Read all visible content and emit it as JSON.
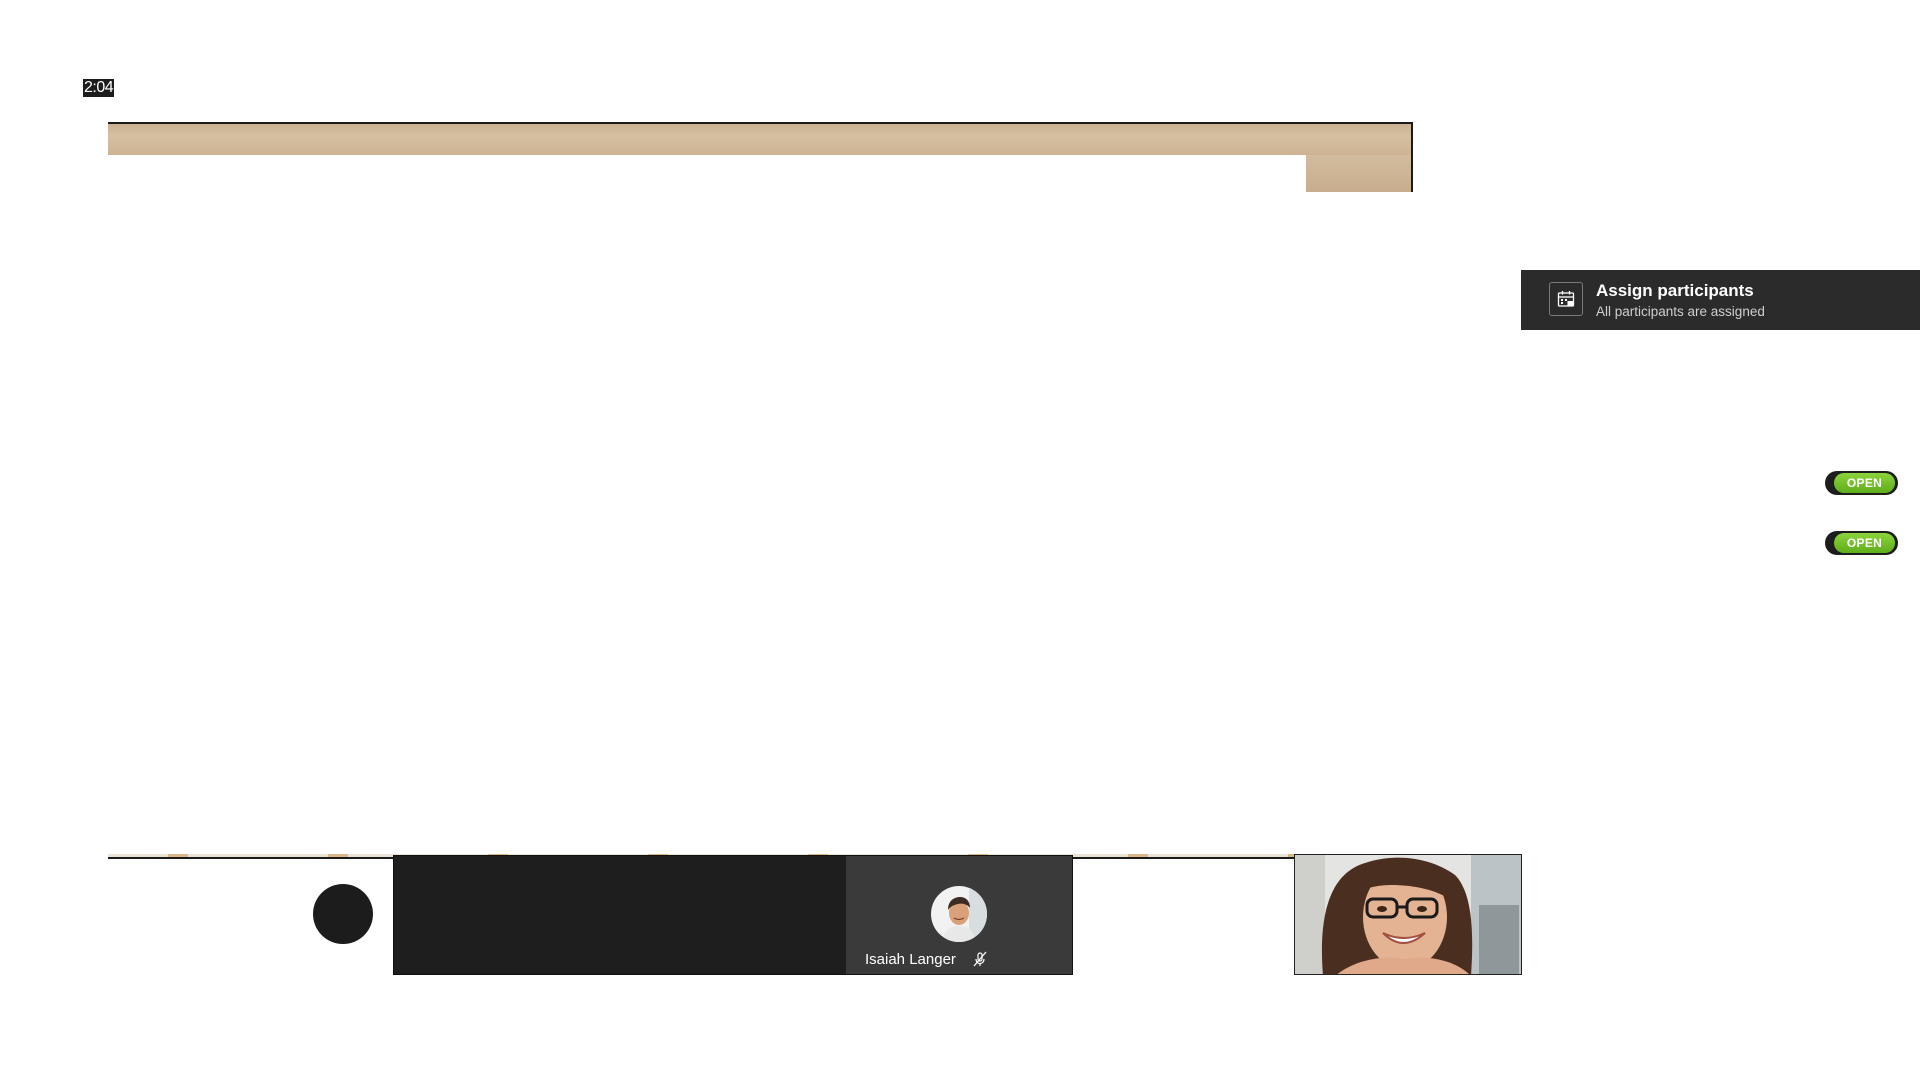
{
  "timer": {
    "value": "2:04"
  },
  "assign_panel": {
    "title": "Assign participants",
    "subtitle": "All participants are assigned",
    "icon": "assign-calendar-icon"
  },
  "rooms": [
    {
      "status_label": "OPEN"
    },
    {
      "status_label": "OPEN"
    }
  ],
  "participants": [
    {
      "name": "Isaiah Langer",
      "muted": true,
      "icon": "mic-off-icon"
    }
  ],
  "colors": {
    "panel_bg": "#2b2b2b",
    "open_green": "#6cc024",
    "strip_bg": "#1e1e1e",
    "tile_bg": "#3a3a3a"
  }
}
